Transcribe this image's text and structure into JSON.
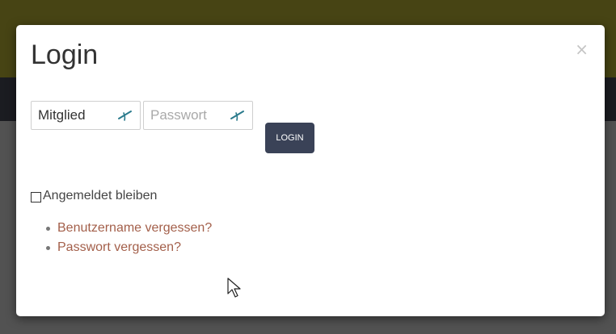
{
  "modal": {
    "title": "Login",
    "close_symbol": "×",
    "member_field": {
      "placeholder": "Mitglied",
      "value": "Mitglied",
      "icon": "pen-icon"
    },
    "password_field": {
      "placeholder": "Passwort",
      "value": "",
      "icon": "pen-icon"
    },
    "login_button": "LOGIN",
    "remember": {
      "label": "Angemeldet bleiben",
      "checked": false
    },
    "links": [
      {
        "label": "Benutzername vergessen?"
      },
      {
        "label": "Passwort vergessen?"
      }
    ]
  },
  "colors": {
    "button": "#3a4257",
    "link": "#a35f4a",
    "icon": "#2a7a8c"
  }
}
